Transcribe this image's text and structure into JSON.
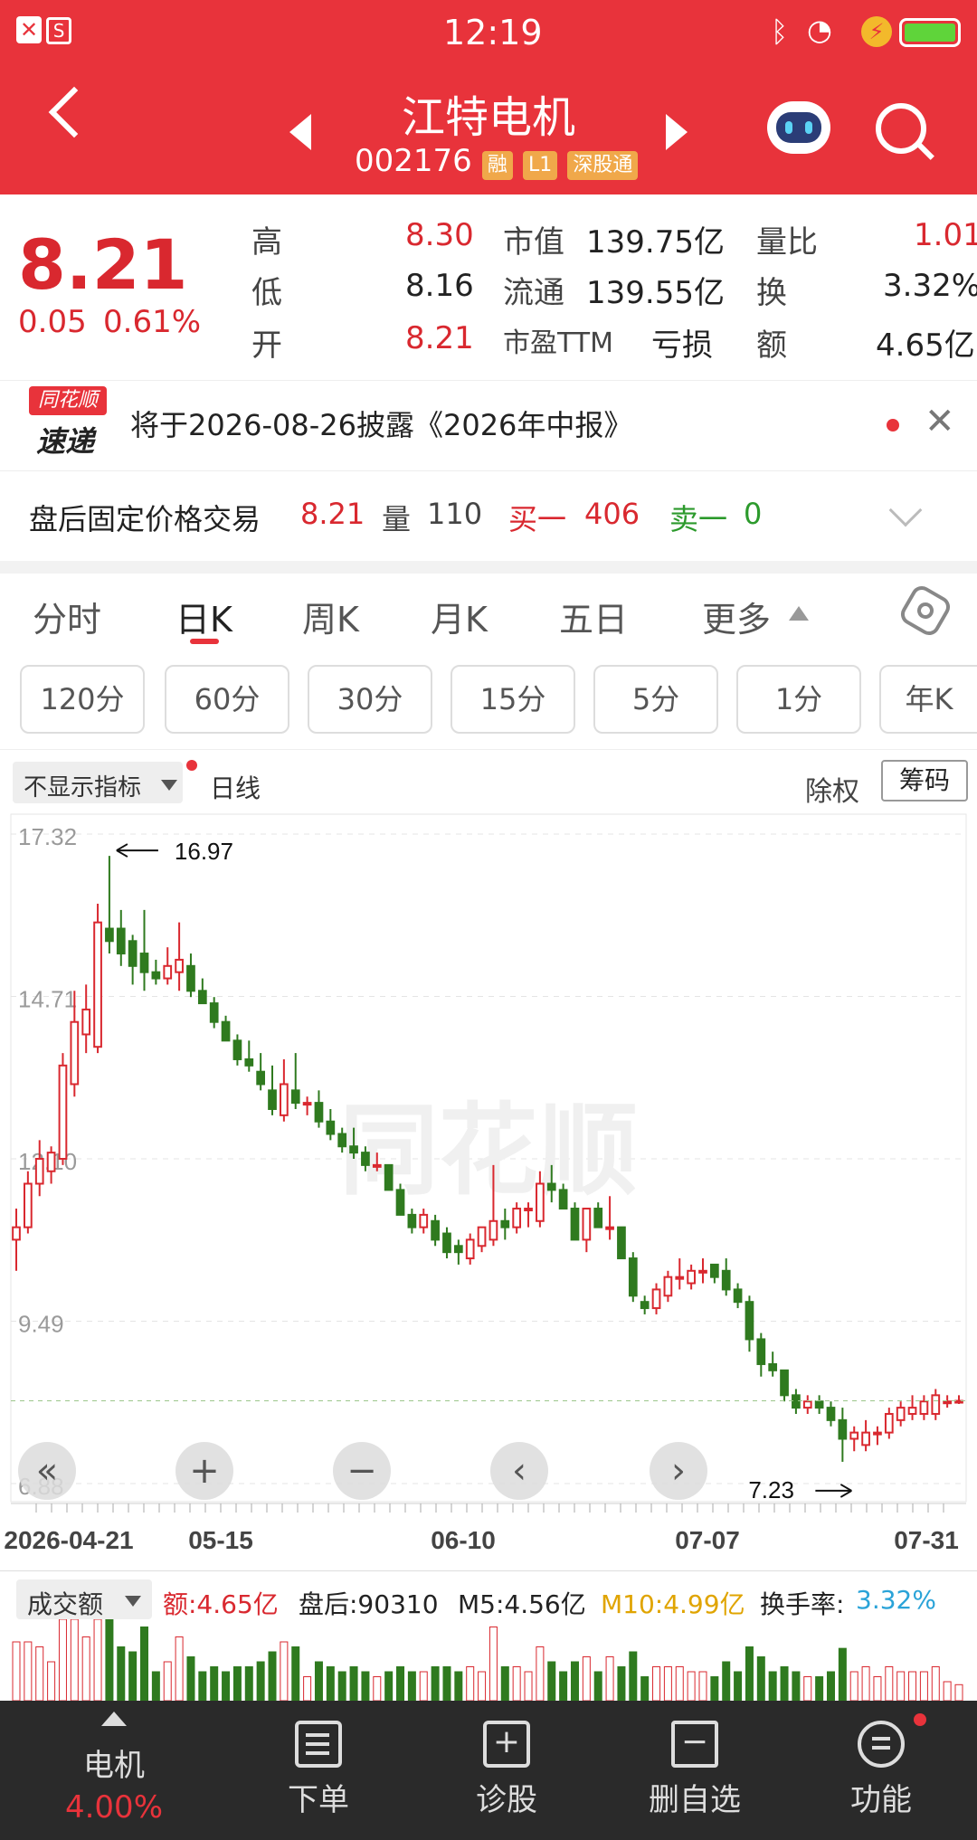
{
  "status_bar": {
    "time": "12:19"
  },
  "header": {
    "title": "江特电机",
    "code": "002176",
    "tags": [
      "融",
      "L1",
      "深股通"
    ]
  },
  "quote": {
    "price": "8.21",
    "change": "0.05",
    "change_pct": "0.61%",
    "high_label": "高",
    "high": "8.30",
    "low_label": "低",
    "low": "8.16",
    "open_label": "开",
    "open": "8.21",
    "mktcap_label": "市值",
    "mktcap": "139.75亿",
    "float_label": "流通",
    "float": "139.55亿",
    "pe_label": "市盈TTM",
    "pe": "亏损",
    "volratio_label": "量比",
    "volratio": "1.01",
    "turnover_label": "换",
    "turnover": "3.32%",
    "amount_label": "额",
    "amount": "4.65亿"
  },
  "news": {
    "logo_top": "同花顺",
    "logo_bottom": "速递",
    "text": "将于2026-08-26披露《2026年中报》"
  },
  "afterhours": {
    "label": "盘后固定价格交易",
    "price": "8.21",
    "vol_label": "量",
    "vol": "110",
    "buy_label": "买一",
    "buy": "406",
    "sell_label": "卖一",
    "sell": "0"
  },
  "period_tabs": [
    "分时",
    "日K",
    "周K",
    "月K",
    "五日",
    "更多"
  ],
  "interval_tabs": [
    "120分",
    "60分",
    "30分",
    "15分",
    "5分",
    "1分",
    "年K"
  ],
  "chart_header": {
    "indicator": "不显示指标",
    "line_type": "日线",
    "adjust": "除权",
    "chips": "筹码"
  },
  "chart_data": {
    "type": "candlestick",
    "y_ticks": [
      "17.32",
      "14.71",
      "12.10",
      "9.49",
      "6.88"
    ],
    "ylim": [
      6.88,
      17.32
    ],
    "x_ticks": [
      "2026-04-21",
      "05-15",
      "06-10",
      "07-07",
      "07-31"
    ],
    "annotations": {
      "high": "16.97",
      "low": "7.23"
    },
    "watermark": "同花顺",
    "candles": [
      [
        10.8,
        11.3,
        10.3,
        11.0
      ],
      [
        11.0,
        11.9,
        10.9,
        11.7
      ],
      [
        11.7,
        12.4,
        11.5,
        12.1
      ],
      [
        11.9,
        12.3,
        11.7,
        12.2
      ],
      [
        12.1,
        13.8,
        12.0,
        13.6
      ],
      [
        13.3,
        14.8,
        13.1,
        14.3
      ],
      [
        14.1,
        14.9,
        13.8,
        14.5
      ],
      [
        13.9,
        16.2,
        13.8,
        15.9
      ],
      [
        15.8,
        16.97,
        15.4,
        15.6
      ],
      [
        15.8,
        16.1,
        15.2,
        15.4
      ],
      [
        15.6,
        15.7,
        14.9,
        15.2
      ],
      [
        15.4,
        16.1,
        14.8,
        15.1
      ],
      [
        15.1,
        15.3,
        14.9,
        15.0
      ],
      [
        15.0,
        15.5,
        14.9,
        15.2
      ],
      [
        15.1,
        15.9,
        14.8,
        15.3
      ],
      [
        15.2,
        15.4,
        14.7,
        14.8
      ],
      [
        14.8,
        15.0,
        14.6,
        14.6
      ],
      [
        14.6,
        14.7,
        14.2,
        14.3
      ],
      [
        14.3,
        14.4,
        14.0,
        14.0
      ],
      [
        14.0,
        14.1,
        13.6,
        13.7
      ],
      [
        13.7,
        14.0,
        13.5,
        13.6
      ],
      [
        13.5,
        13.8,
        13.2,
        13.3
      ],
      [
        13.2,
        13.6,
        12.8,
        12.9
      ],
      [
        12.8,
        13.7,
        12.7,
        13.3
      ],
      [
        13.2,
        13.8,
        12.9,
        13.0
      ],
      [
        13.0,
        13.1,
        12.8,
        13.0
      ],
      [
        13.0,
        13.2,
        12.6,
        12.7
      ],
      [
        12.7,
        12.9,
        12.4,
        12.5
      ],
      [
        12.5,
        12.6,
        12.2,
        12.3
      ],
      [
        12.3,
        12.6,
        12.1,
        12.2
      ],
      [
        12.2,
        12.3,
        11.9,
        12.0
      ],
      [
        12.0,
        12.2,
        11.9,
        12.0
      ],
      [
        12.0,
        12.0,
        11.6,
        11.6
      ],
      [
        11.6,
        11.7,
        11.2,
        11.2
      ],
      [
        11.2,
        11.3,
        10.9,
        11.0
      ],
      [
        11.0,
        11.3,
        10.9,
        11.2
      ],
      [
        11.1,
        11.2,
        10.7,
        10.8
      ],
      [
        10.9,
        11.0,
        10.5,
        10.6
      ],
      [
        10.7,
        10.8,
        10.4,
        10.6
      ],
      [
        10.5,
        10.9,
        10.4,
        10.8
      ],
      [
        10.7,
        11.0,
        10.6,
        11.0
      ],
      [
        10.8,
        12.0,
        10.7,
        11.1
      ],
      [
        11.1,
        11.3,
        10.8,
        11.0
      ],
      [
        11.0,
        11.4,
        10.9,
        11.3
      ],
      [
        11.3,
        11.4,
        11.0,
        11.3
      ],
      [
        11.1,
        11.9,
        11.0,
        11.7
      ],
      [
        11.7,
        12.0,
        11.4,
        11.6
      ],
      [
        11.6,
        11.7,
        11.3,
        11.3
      ],
      [
        11.3,
        11.4,
        10.8,
        10.8
      ],
      [
        10.8,
        11.3,
        10.6,
        11.3
      ],
      [
        11.3,
        11.4,
        11.0,
        11.0
      ],
      [
        11.0,
        11.5,
        10.8,
        11.0
      ],
      [
        11.0,
        11.0,
        10.5,
        10.5
      ],
      [
        10.5,
        10.6,
        9.8,
        9.9
      ],
      [
        9.8,
        9.9,
        9.6,
        9.7
      ],
      [
        9.7,
        10.1,
        9.6,
        10.0
      ],
      [
        9.9,
        10.3,
        9.8,
        10.2
      ],
      [
        10.2,
        10.5,
        10.0,
        10.2
      ],
      [
        10.1,
        10.4,
        10.0,
        10.3
      ],
      [
        10.3,
        10.5,
        10.1,
        10.3
      ],
      [
        10.4,
        10.4,
        10.1,
        10.2
      ],
      [
        10.3,
        10.5,
        9.9,
        10.0
      ],
      [
        10.0,
        10.1,
        9.7,
        9.8
      ],
      [
        9.8,
        9.9,
        9.0,
        9.2
      ],
      [
        9.2,
        9.3,
        8.6,
        8.8
      ],
      [
        8.8,
        9.0,
        8.6,
        8.7
      ],
      [
        8.7,
        8.7,
        8.2,
        8.3
      ],
      [
        8.3,
        8.4,
        8.0,
        8.1
      ],
      [
        8.1,
        8.3,
        8.0,
        8.2
      ],
      [
        8.2,
        8.3,
        8.0,
        8.1
      ],
      [
        8.1,
        8.2,
        7.8,
        7.9
      ],
      [
        7.9,
        8.1,
        7.23,
        7.6
      ],
      [
        7.6,
        7.8,
        7.4,
        7.7
      ],
      [
        7.5,
        7.9,
        7.4,
        7.7
      ],
      [
        7.7,
        7.8,
        7.5,
        7.7
      ],
      [
        7.7,
        8.1,
        7.6,
        8.0
      ],
      [
        7.9,
        8.2,
        7.8,
        8.1
      ],
      [
        8.0,
        8.3,
        7.9,
        8.1
      ],
      [
        8.0,
        8.3,
        7.9,
        8.2
      ],
      [
        8.0,
        8.4,
        7.9,
        8.3
      ],
      [
        8.2,
        8.3,
        8.1,
        8.2
      ],
      [
        8.2,
        8.3,
        8.16,
        8.21
      ]
    ]
  },
  "chart_controls": [
    "«",
    "+",
    "−",
    "‹",
    "›"
  ],
  "volume_header": {
    "selector": "成交额",
    "amount": "额:4.65亿",
    "after": "盘后:90310",
    "m5": "M5:4.56亿",
    "m10": "M10:4.99亿",
    "turnover_label": "换手率:",
    "turnover": "3.32%"
  },
  "bottom_nav": {
    "sector_name": "电机",
    "sector_pct": "4.00%",
    "items": [
      "下单",
      "诊股",
      "删自选",
      "功能"
    ]
  },
  "colors": {
    "header": "#e8333b",
    "up": "#d9282f",
    "down": "#2f7a1f",
    "nav_bg": "#2a2a2a"
  }
}
